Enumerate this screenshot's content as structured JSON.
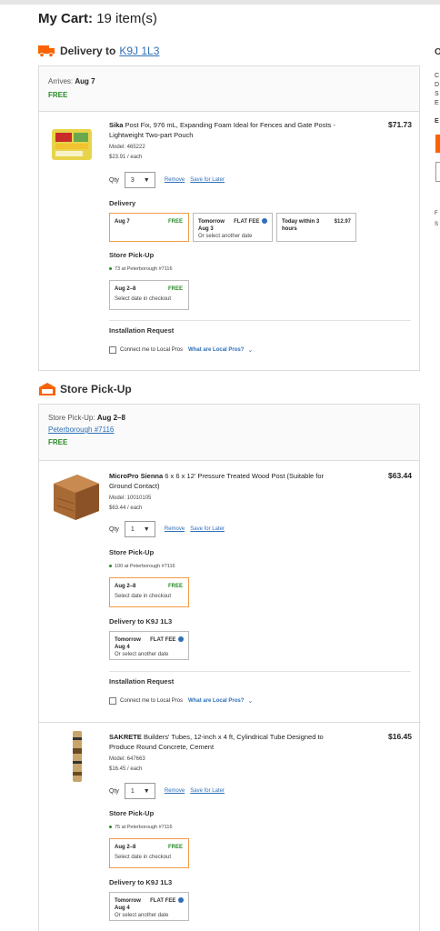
{
  "cart": {
    "title_bold": "My Cart:",
    "title_count": "19 item(s)"
  },
  "delivery_section": {
    "heading": "Delivery to",
    "postal": "K9J 1L3",
    "arrives_label": "Arrives:",
    "arrives_date": "Aug 7",
    "free_label": "FREE"
  },
  "pickup_section": {
    "heading": "Store Pick-Up",
    "pickup_label": "Store Pick-Up:",
    "pickup_dates": "Aug 2–8",
    "store_link": "Peterborough #7116",
    "free_label": "FREE"
  },
  "items": [
    {
      "brand": "Sika",
      "title": "Post Fix, 976 mL, Expanding Foam Ideal for Fences and Gate Posts - Lightweight Two-part Pouch",
      "price": "$71.73",
      "model": "Model: 465222",
      "unit_price": "$23.91 / each",
      "qty_label": "Qty",
      "qty": "3",
      "remove": "Remove",
      "save": "Save for Later",
      "delivery_label": "Delivery",
      "delivery_opts": [
        {
          "title": "Aug 7",
          "fee": "FREE"
        },
        {
          "title": "Tomorrow",
          "sub": "Aug 3",
          "fee": "FLAT FEE",
          "extra": "Or select another date"
        },
        {
          "title": "Today within 3",
          "sub": "hours",
          "fee": "$12.97"
        }
      ],
      "pickup_label": "Store Pick-Up",
      "stock": "73 at Peterborough #7116",
      "pickup_opt": {
        "title": "Aug 2–8",
        "fee": "FREE",
        "sub": "Select date in checkout"
      },
      "install_label": "Installation Request",
      "install_cb": "Connect me to Local Pros",
      "install_link": "What are Local Pros?"
    },
    {
      "brand": "MicroPro Sienna",
      "title": "6 x 6 x 12' Pressure Treated Wood Post (Suitable for Ground Contact)",
      "price": "$63.44",
      "model": "Model: 10010105",
      "unit_price": "$63.44 / each",
      "qty_label": "Qty",
      "qty": "1",
      "remove": "Remove",
      "save": "Save for Later",
      "pickup_label": "Store Pick-Up",
      "stock": "100 at Peterborough #7116",
      "pickup_opt": {
        "title": "Aug 2–8",
        "fee": "FREE",
        "sub": "Select date in checkout"
      },
      "delivery_label": "Delivery to K9J 1L3",
      "delivery_opt": {
        "title": "Tomorrow",
        "sub": "Aug 4",
        "fee": "FLAT FEE",
        "extra": "Or select another date"
      },
      "install_label": "Installation Request",
      "install_cb": "Connect me to Local Pros",
      "install_link": "What are Local Pros?"
    },
    {
      "brand": "SAKRETE",
      "title": "Builders' Tubes, 12-inch x 4 ft, Cylindrical Tube Designed to Produce Round Concrete, Cement",
      "price": "$16.45",
      "model": "Model: 647663",
      "unit_price": "$16.45 / each",
      "qty_label": "Qty",
      "qty": "1",
      "remove": "Remove",
      "save": "Save for Later",
      "pickup_label": "Store Pick-Up",
      "stock": "75 at Peterborough #7116",
      "pickup_opt": {
        "title": "Aug 2–8",
        "fee": "FREE",
        "sub": "Select date in checkout"
      },
      "delivery_label": "Delivery to K9J 1L3",
      "delivery_opt": {
        "title": "Tomorrow",
        "sub": "Aug 4",
        "fee": "FLAT FEE",
        "extra": "Or select another date"
      }
    }
  ],
  "right_sidebar": {
    "clip_letters": [
      "O",
      "C",
      "D",
      "S",
      "E",
      "E",
      "F",
      "S"
    ]
  },
  "colors": {
    "accent": "#f96302",
    "link": "#2e6fb7",
    "free": "#2a8a2a",
    "selected_border": "#f29b45"
  }
}
